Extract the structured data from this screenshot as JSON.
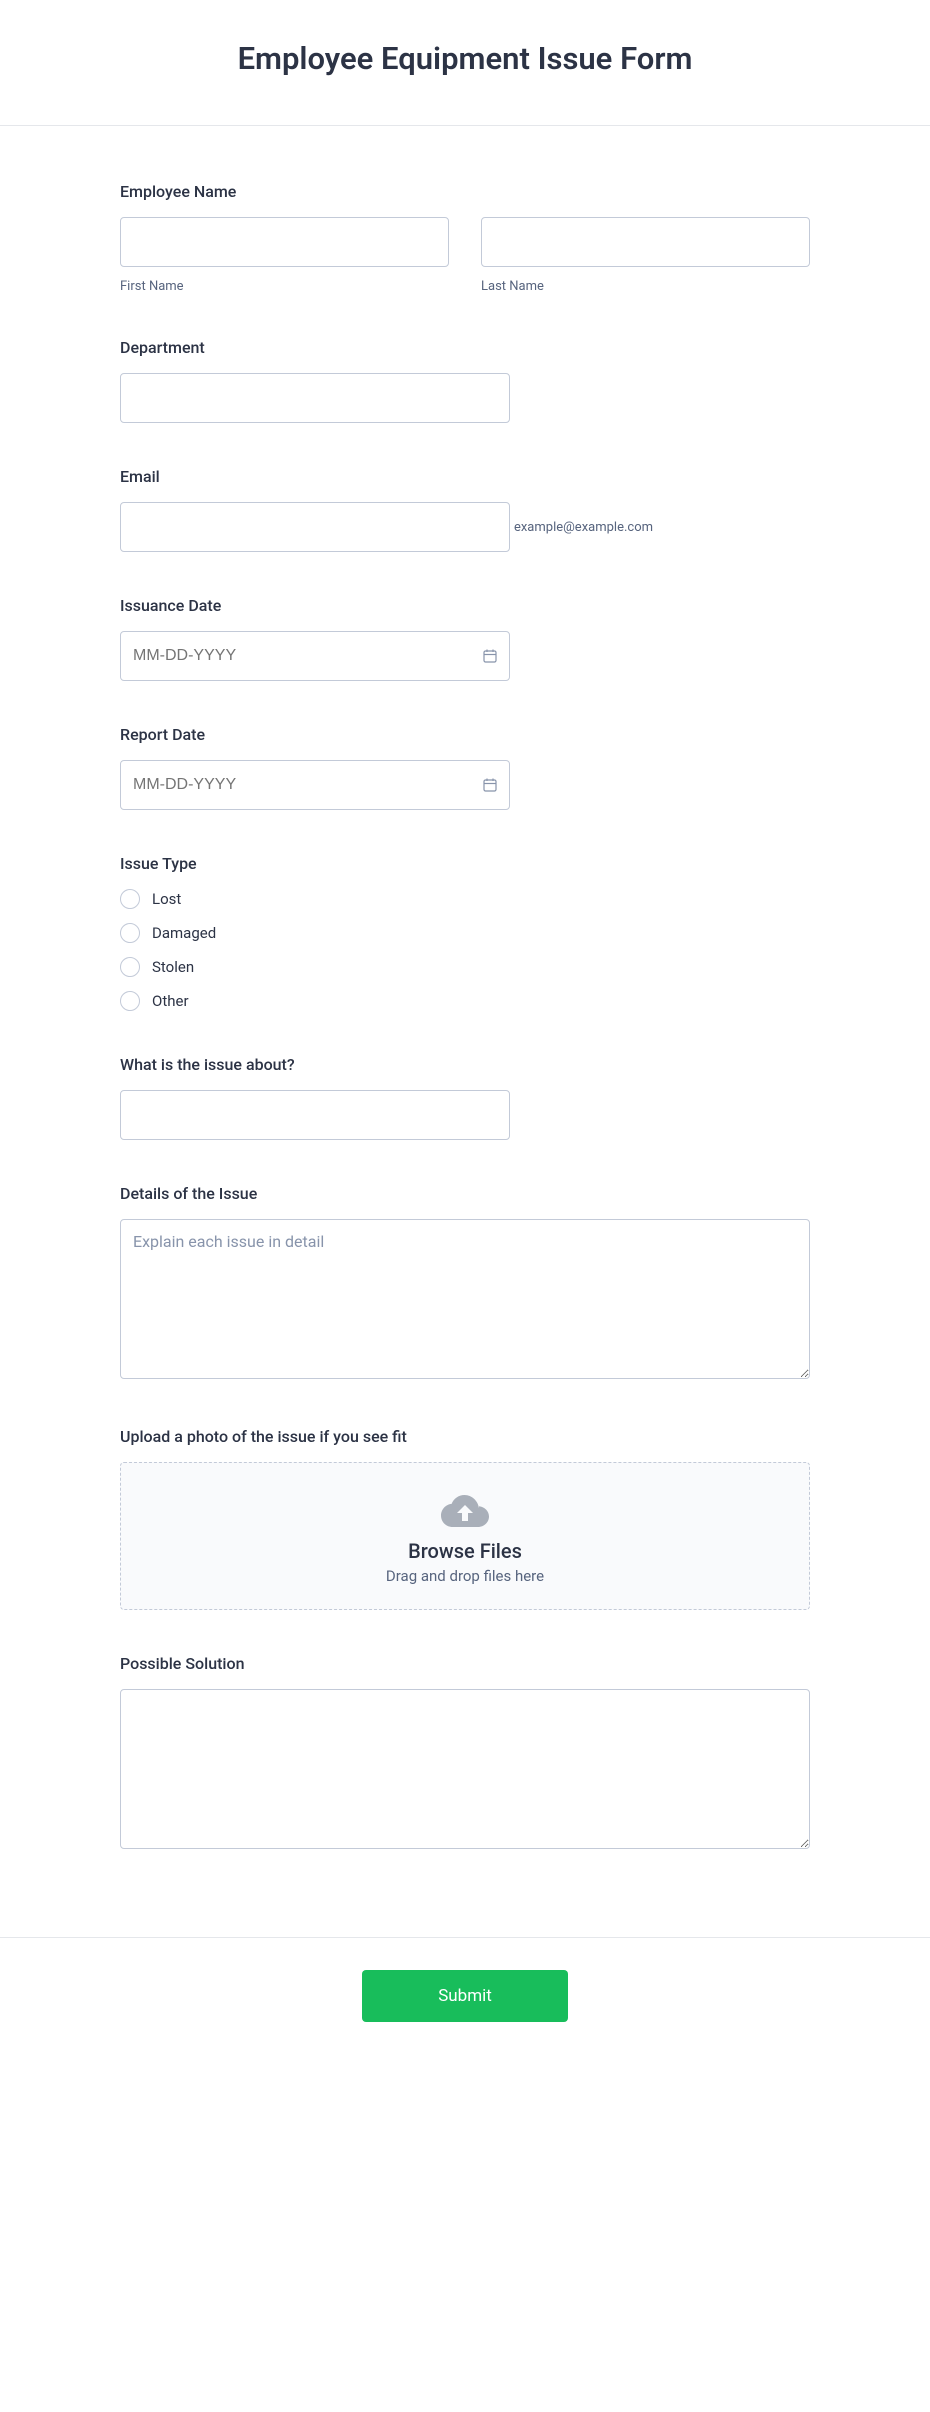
{
  "header": {
    "title": "Employee Equipment Issue Form"
  },
  "employee_name": {
    "label": "Employee Name",
    "first_sub": "First Name",
    "last_sub": "Last Name"
  },
  "department": {
    "label": "Department"
  },
  "email": {
    "label": "Email",
    "sub": "example@example.com"
  },
  "issuance_date": {
    "label": "Issuance Date",
    "placeholder": "MM-DD-YYYY"
  },
  "report_date": {
    "label": "Report Date",
    "placeholder": "MM-DD-YYYY"
  },
  "issue_type": {
    "label": "Issue Type",
    "options": [
      "Lost",
      "Damaged",
      "Stolen",
      "Other"
    ]
  },
  "issue_about": {
    "label": "What is the issue about?"
  },
  "details": {
    "label": "Details of the Issue",
    "placeholder": "Explain each issue in detail"
  },
  "upload": {
    "label": "Upload a photo of the issue if you see fit",
    "browse": "Browse Files",
    "drop": "Drag and drop files here"
  },
  "solution": {
    "label": "Possible Solution"
  },
  "submit": {
    "label": "Submit"
  }
}
